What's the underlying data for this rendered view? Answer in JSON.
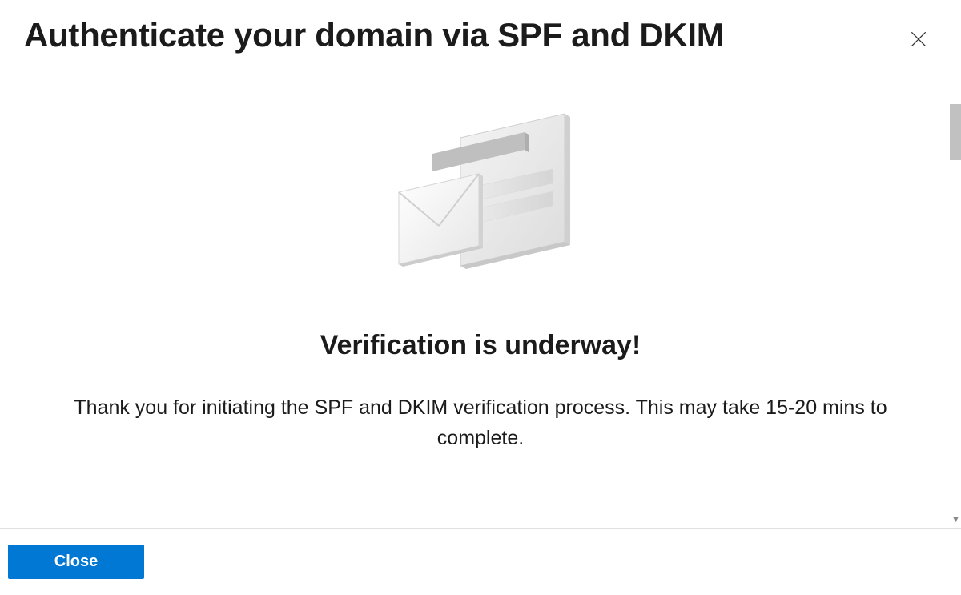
{
  "dialog": {
    "title": "Authenticate your domain via SPF and DKIM",
    "status_heading": "Verification is underway!",
    "status_description": "Thank you for initiating the SPF and DKIM verification process. This may take 15-20 mins to complete.",
    "close_label": "Close"
  }
}
